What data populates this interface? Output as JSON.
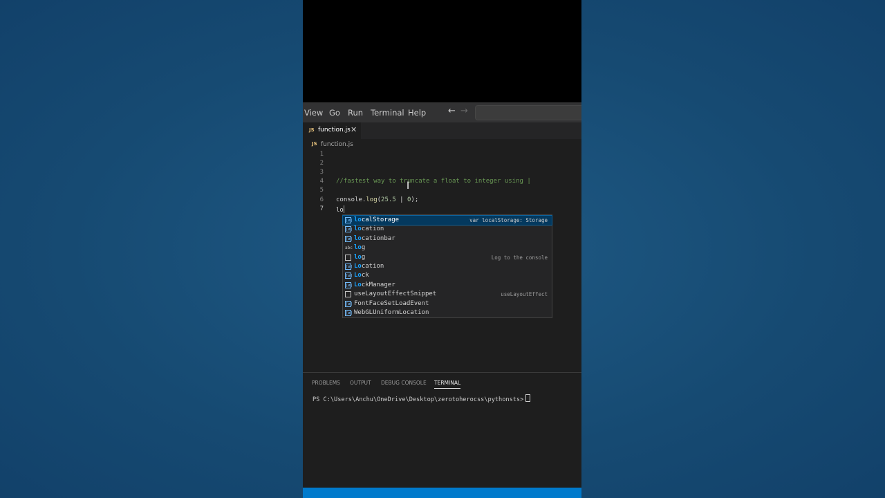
{
  "menubar": {
    "items": [
      "View",
      "Go",
      "Run",
      "Terminal",
      "Help"
    ],
    "back_icon": "arrow-left-icon",
    "forward_icon": "arrow-right-icon"
  },
  "tab": {
    "icon": "JS",
    "name": "function.js",
    "close_icon": "close-icon"
  },
  "breadcrumb": {
    "icon": "JS",
    "name": "function.js"
  },
  "editor": {
    "lines": [
      {
        "n": "1",
        "text": ""
      },
      {
        "n": "2",
        "text": ""
      },
      {
        "n": "3",
        "text": ""
      },
      {
        "n": "4",
        "text": "//fastest way to truncate a float to integer using |"
      },
      {
        "n": "5",
        "text": ""
      },
      {
        "n": "6",
        "text": "console.log(25.5 | 0);"
      },
      {
        "n": "7",
        "text": "lo"
      }
    ]
  },
  "suggestions": [
    {
      "icon": "variable",
      "match": "lo",
      "rest": "calStorage",
      "label": "localStorage",
      "detail": "var localStorage: Storage",
      "selected": true
    },
    {
      "icon": "variable",
      "match": "lo",
      "rest": "cation",
      "label": "location",
      "detail": ""
    },
    {
      "icon": "variable",
      "match": "lo",
      "rest": "cationbar",
      "label": "locationbar",
      "detail": ""
    },
    {
      "icon": "text",
      "match": "lo",
      "rest": "g",
      "label": "log",
      "detail": ""
    },
    {
      "icon": "snippet",
      "match": "lo",
      "rest": "g",
      "label": "log",
      "detail": "Log to the console"
    },
    {
      "icon": "variable",
      "match": "Lo",
      "rest": "cation",
      "label": "Location",
      "detail": ""
    },
    {
      "icon": "variable",
      "match": "Lo",
      "rest": "ck",
      "label": "Lock",
      "detail": ""
    },
    {
      "icon": "variable",
      "match": "Lo",
      "rest": "ckManager",
      "label": "LockManager",
      "detail": ""
    },
    {
      "icon": "snippet",
      "match": "",
      "rest": "useLayoutEffectSnippet",
      "label": "useLayoutEffectSnippet",
      "detail": "useLayoutEffect"
    },
    {
      "icon": "variable",
      "match": "",
      "rest": "FontFaceSetLoadEvent",
      "label": "FontFaceSetLoadEvent",
      "detail": ""
    },
    {
      "icon": "variable",
      "match": "",
      "rest": "WebGLUniformLocation",
      "label": "WebGLUniformLocation",
      "detail": ""
    }
  ],
  "panel": {
    "tabs": [
      "PROBLEMS",
      "OUTPUT",
      "DEBUG CONSOLE",
      "TERMINAL"
    ],
    "active_tab": "TERMINAL",
    "terminal_prompt": "PS C:\\Users\\Anchu\\OneDrive\\Desktop\\zerotoherocss\\pythonsts>"
  },
  "colors": {
    "accent": "#007acc",
    "background": "#164a72",
    "editor": "#1e1e1e"
  }
}
